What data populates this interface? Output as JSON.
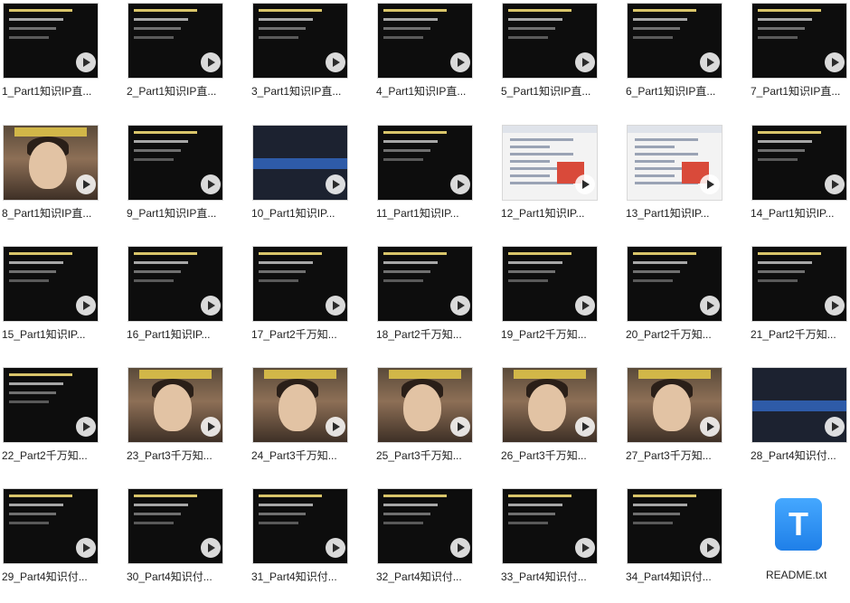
{
  "files": [
    {
      "label": "1_Part1知识IP直...",
      "kind": "slide"
    },
    {
      "label": "2_Part1知识IP直...",
      "kind": "slide"
    },
    {
      "label": "3_Part1知识IP直...",
      "kind": "slide"
    },
    {
      "label": "4_Part1知识IP直...",
      "kind": "slide"
    },
    {
      "label": "5_Part1知识IP直...",
      "kind": "slide"
    },
    {
      "label": "6_Part1知识IP直...",
      "kind": "slide"
    },
    {
      "label": "7_Part1知识IP直...",
      "kind": "slide"
    },
    {
      "label": "8_Part1知识IP直...",
      "kind": "photo"
    },
    {
      "label": "9_Part1知识IP直...",
      "kind": "slide"
    },
    {
      "label": "10_Part1知识IP...",
      "kind": "dark-screen"
    },
    {
      "label": "11_Part1知识IP...",
      "kind": "slide"
    },
    {
      "label": "12_Part1知识IP...",
      "kind": "screen"
    },
    {
      "label": "13_Part1知识IP...",
      "kind": "screen"
    },
    {
      "label": "14_Part1知识IP...",
      "kind": "slide"
    },
    {
      "label": "15_Part1知识IP...",
      "kind": "slide"
    },
    {
      "label": "16_Part1知识IP...",
      "kind": "slide"
    },
    {
      "label": "17_Part2千万知...",
      "kind": "slide"
    },
    {
      "label": "18_Part2千万知...",
      "kind": "slide"
    },
    {
      "label": "19_Part2千万知...",
      "kind": "slide"
    },
    {
      "label": "20_Part2千万知...",
      "kind": "slide"
    },
    {
      "label": "21_Part2千万知...",
      "kind": "slide"
    },
    {
      "label": "22_Part2千万知...",
      "kind": "slide"
    },
    {
      "label": "23_Part3千万知...",
      "kind": "photo"
    },
    {
      "label": "24_Part3千万知...",
      "kind": "photo"
    },
    {
      "label": "25_Part3千万知...",
      "kind": "photo"
    },
    {
      "label": "26_Part3千万知...",
      "kind": "photo"
    },
    {
      "label": "27_Part3千万知...",
      "kind": "photo"
    },
    {
      "label": "28_Part4知识付...",
      "kind": "dark-screen"
    },
    {
      "label": "29_Part4知识付...",
      "kind": "slide"
    },
    {
      "label": "30_Part4知识付...",
      "kind": "slide"
    },
    {
      "label": "31_Part4知识付...",
      "kind": "slide"
    },
    {
      "label": "32_Part4知识付...",
      "kind": "slide"
    },
    {
      "label": "33_Part4知识付...",
      "kind": "slide"
    },
    {
      "label": "34_Part4知识付...",
      "kind": "slide"
    }
  ],
  "readme": {
    "label": "README.txt",
    "icon_glyph": "T",
    "icon_name": "txt-file-icon"
  },
  "colors": {
    "highlight": "#d9c56a",
    "txt_icon": "#1f7fe8"
  }
}
